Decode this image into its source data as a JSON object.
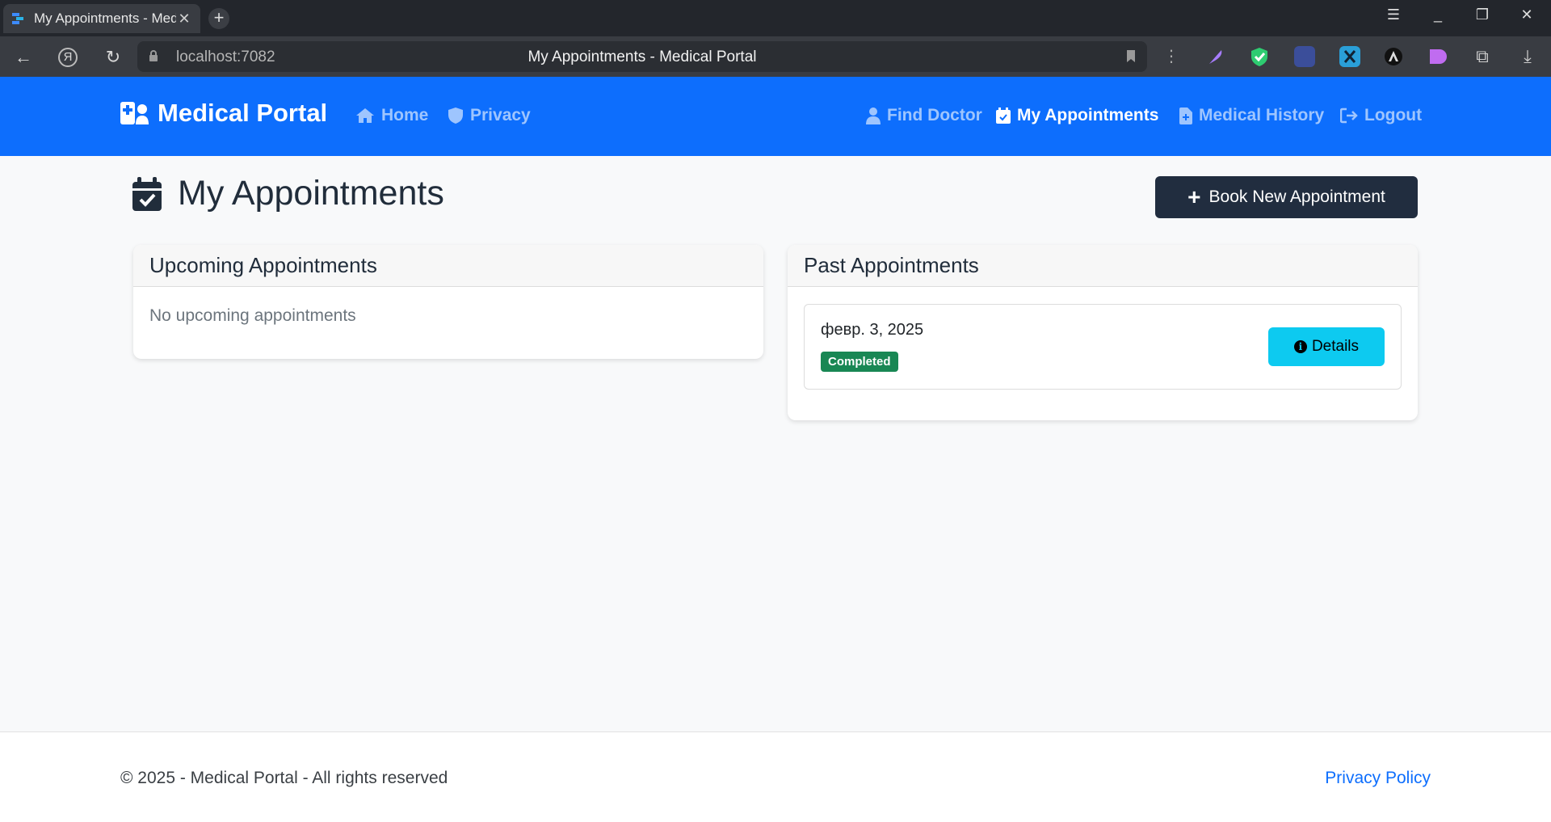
{
  "browser": {
    "tab_title": "My Appointments - Medical Portal",
    "tab_close": "✕",
    "new_tab": "+",
    "url": "localhost:7082",
    "page_title": "My Appointments - Medical Portal",
    "controls": {
      "menu": "☰",
      "minimize": "_",
      "restore": "❐",
      "close": "✕"
    },
    "nav": {
      "back": "←",
      "yandex": "Я",
      "reload": "↻"
    }
  },
  "navbar": {
    "brand": "Medical Portal",
    "links_left": [
      {
        "label": "Home",
        "icon": "home-icon"
      },
      {
        "label": "Privacy",
        "icon": "shield-icon"
      }
    ],
    "links_right": [
      {
        "label": "Find Doctor",
        "icon": "user-doctor-icon",
        "active": false
      },
      {
        "label": "My Appointments",
        "icon": "calendar-check-icon",
        "active": true
      },
      {
        "label": "Medical History",
        "icon": "file-medical-icon",
        "active": false
      },
      {
        "label": "Logout",
        "icon": "sign-out-icon",
        "active": false
      }
    ]
  },
  "main": {
    "title": "My Appointments",
    "book_button": "Book New Appointment",
    "upcoming": {
      "header": "Upcoming Appointments",
      "empty_text": "No upcoming appointments"
    },
    "past": {
      "header": "Past Appointments",
      "items": [
        {
          "date": "февр. 3, 2025",
          "status": "Completed",
          "button": "Details"
        }
      ]
    }
  },
  "footer": {
    "copyright": "© 2025 - Medical Portal - All rights reserved",
    "privacy_link": "Privacy Policy"
  },
  "colors": {
    "primary": "#0d6efd",
    "dark_button": "#212d3f",
    "success": "#198754",
    "info": "#0dcaf0"
  }
}
